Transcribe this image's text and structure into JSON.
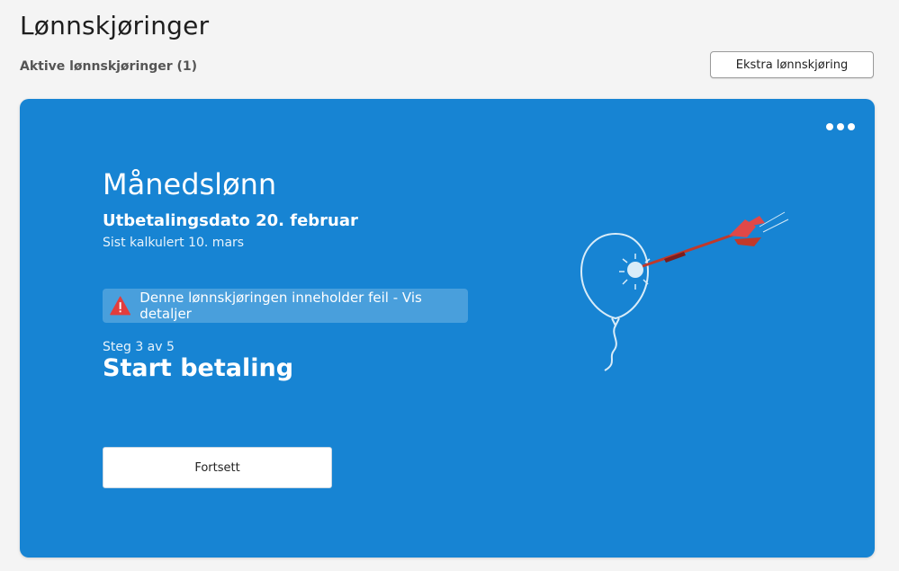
{
  "header": {
    "title": "Lønnskjøringer",
    "active_section": "Aktive lønnskjøringer (1)",
    "extra_button_label": "Ekstra lønnskjøring"
  },
  "card": {
    "background_color": "#1784d3",
    "title": "Månedslønn",
    "payout_date": "Utbetalingsdato 20. februar",
    "calculated": "Sist kalkulert 10. mars",
    "error_message": "Denne lønnskjøringen inneholder feil - Vis detaljer",
    "error_icon": "warning-triangle-icon",
    "error_icon_color": "#e23d3d",
    "step_label": "Steg 3 av 5",
    "step_title": "Start betaling",
    "continue_label": "Fortsett",
    "menu_icon": "more-horizontal-icon",
    "illustration": "balloon-dart-illustration"
  }
}
